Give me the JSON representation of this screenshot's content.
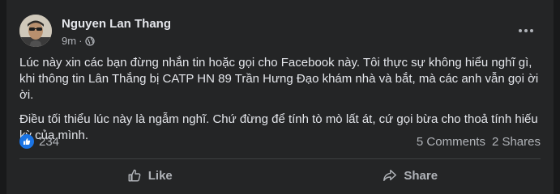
{
  "post": {
    "author": "Nguyen Lan Thang",
    "time": "9m",
    "separator": "·",
    "audience_icon": "globe-icon",
    "menu_icon": "more-horizontal-icon",
    "paragraphs": [
      "Lúc này xin các bạn đừng nhắn tin hoặc gọi cho Facebook này. Tôi thực sự không hiểu nghĩ gì, khi thông tin Lân Thắng bị CATP HN 89 Trần Hưng Đạo khám nhà và bắt, mà các anh vẫn gọi ời ời.",
      "Điều tối thiểu lúc này là ngẫm nghĩ. Chứ đừng để tính tò mò lất át, cứ gọi bừa cho thoả tính hiếu kỳ của mình."
    ]
  },
  "stats": {
    "reaction_icon": "like-reaction-icon",
    "reaction_count": "234",
    "comments": "5 Comments",
    "shares": "2 Shares"
  },
  "actions": {
    "like_label": "Like",
    "share_label": "Share"
  },
  "colors": {
    "background": "#18191a",
    "card": "#242526",
    "primary_text": "#e4e6eb",
    "secondary_text": "#b0b3b8",
    "like_blue": "#1b74e4",
    "divider": "#3e4042"
  }
}
